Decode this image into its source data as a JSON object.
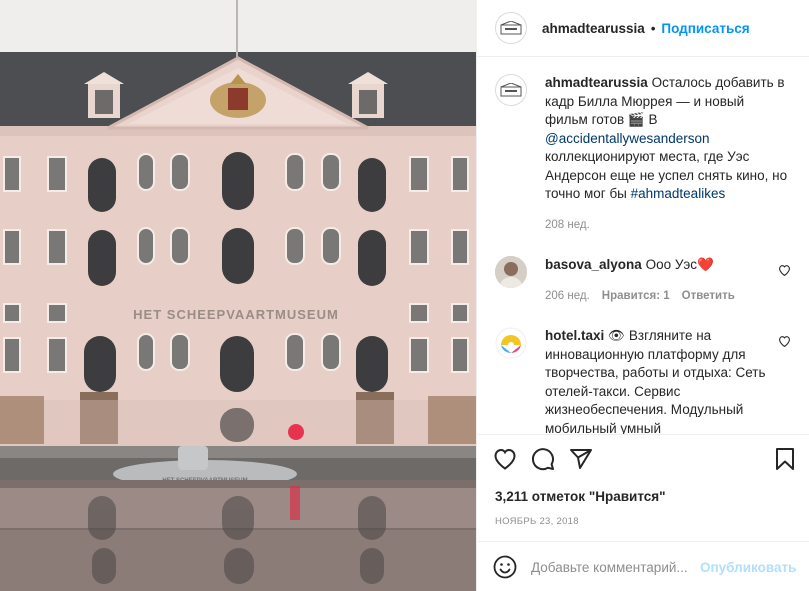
{
  "post": {
    "image_alt": "Het Scheepvaartmuseum building facade with submarine in the water",
    "facade_text": "HET SCHEEPVAARTMUSEUM",
    "boat_text": "HET SCHEEPVAARTMUSEUM"
  },
  "header": {
    "username": "ahmadtearussia",
    "separator": "•",
    "follow_label": "Подписаться"
  },
  "caption": {
    "username": "ahmadtearussia",
    "text_1": " Осталось добавить в кадр Билла Мюррея — и новый фильм готов 🎬 В ",
    "mention": "@accidentallywesanderson",
    "text_2": " коллекционируют места, где Уэс Андерсон еще не успел снять кино, но точно мог бы ",
    "hashtag": "#ahmadtealikes",
    "time": "208 нед."
  },
  "comments": [
    {
      "username": "basova_alyona",
      "text": " Ооо Уэс❤️",
      "time": "206 нед.",
      "likes": "Нравится: 1",
      "reply": "Ответить"
    },
    {
      "username": "hotel.taxi",
      "text": " 👁 Взгляните на инновационную платформу для творчества, работы и отдыха: Сеть отелей-такси. Сервис жизнеобеспечения. Модульный мобильный умный"
    }
  ],
  "actions": {
    "likes_text": "3,211 отметок \"Нравится\"",
    "date": "НОЯБРЬ 23, 2018"
  },
  "add_comment": {
    "placeholder": "Добавьте комментарий...",
    "publish_label": "Опубликовать"
  },
  "colors": {
    "accent": "#0095f6",
    "link": "#00376b",
    "muted": "#8e8e8e",
    "heart": "#ed4956"
  },
  "icons": [
    "heart-icon",
    "comment-icon",
    "share-icon",
    "bookmark-icon",
    "emoji-icon"
  ]
}
